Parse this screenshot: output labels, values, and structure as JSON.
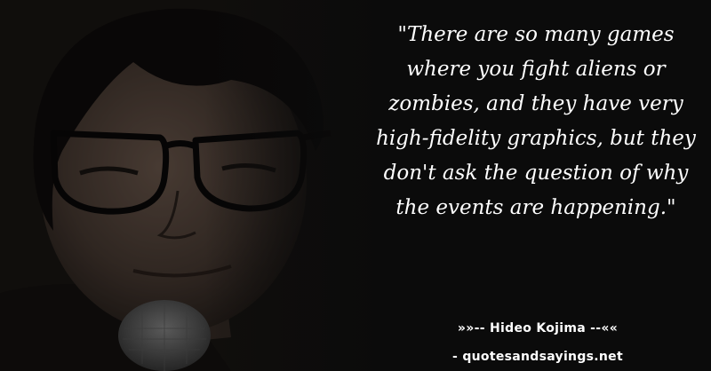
{
  "quote": {
    "text": "\"There are so many games where you fight aliens or zombies, and they have very high-fidelity graphics, but they don't ask the question of why the events are happening.\"",
    "author_line": "»»-- Hideo Kojima --««",
    "source": "- quotesandsayings.net"
  },
  "colors": {
    "background": "#0b0b0b",
    "text": "#ffffff"
  }
}
